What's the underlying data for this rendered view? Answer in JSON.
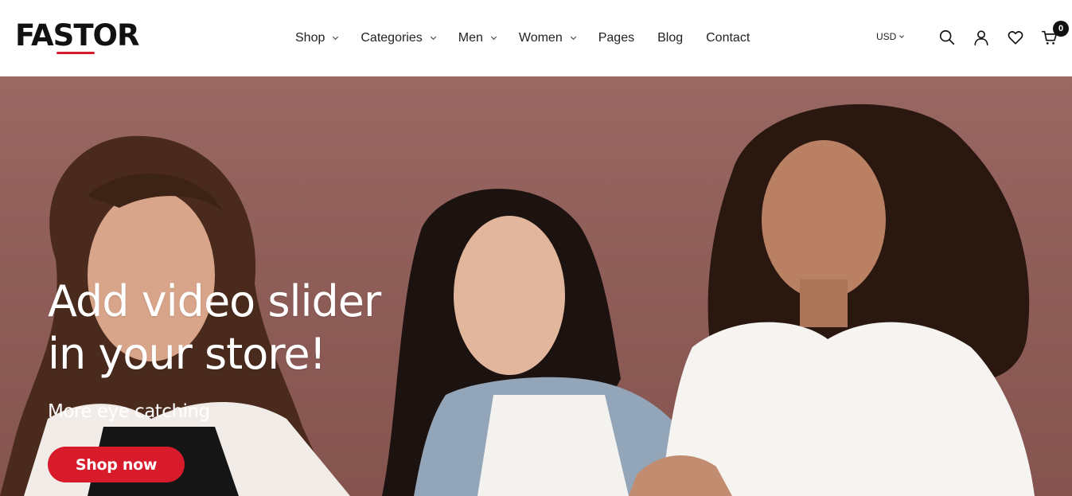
{
  "brand": {
    "name": "FASTOR",
    "accent": "#d81b2b"
  },
  "nav": {
    "items": [
      {
        "label": "Shop",
        "has_dropdown": true
      },
      {
        "label": "Categories",
        "has_dropdown": true
      },
      {
        "label": "Men",
        "has_dropdown": true
      },
      {
        "label": "Women",
        "has_dropdown": true
      },
      {
        "label": "Pages",
        "has_dropdown": false
      },
      {
        "label": "Blog",
        "has_dropdown": false
      },
      {
        "label": "Contact",
        "has_dropdown": false
      }
    ]
  },
  "header": {
    "currency": "USD",
    "icons": [
      "search-icon",
      "user-icon",
      "heart-icon",
      "cart-icon"
    ],
    "cart_count": "0"
  },
  "hero": {
    "title_line1": "Add video slider",
    "title_line2": "in your store!",
    "subtitle": "More eye catching",
    "cta_label": "Shop now",
    "background_color": "#93625d"
  }
}
